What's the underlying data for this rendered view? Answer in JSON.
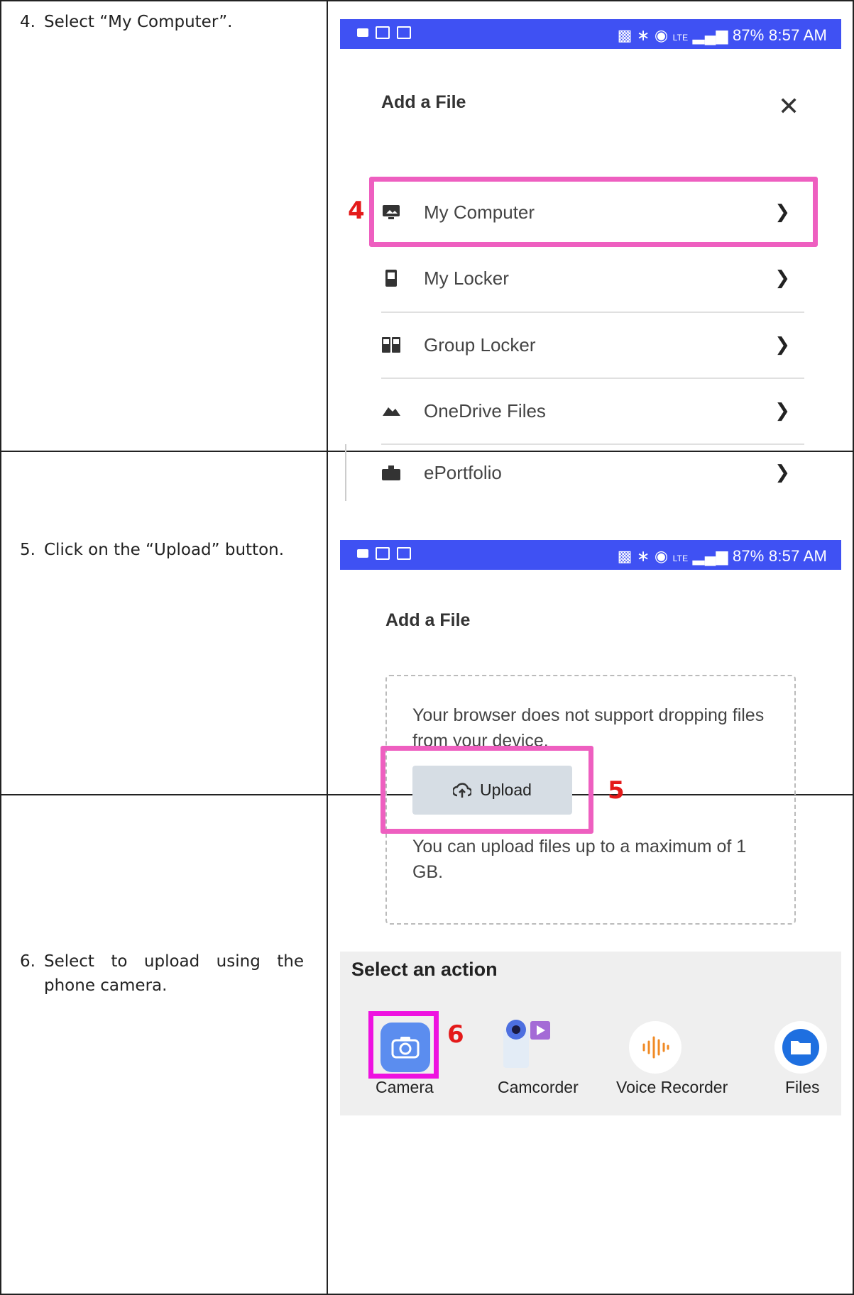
{
  "rows": [
    {
      "step_number": "4.",
      "instruction": "Select “My Computer”.",
      "status_bar": {
        "time_battery": "87% 8:57 AM",
        "network": "LTE"
      },
      "dialog_title": "Add a File",
      "close_icon": "close-icon",
      "menu_items": [
        {
          "label": "My Computer",
          "icon": "monitor-icon"
        },
        {
          "label": "My Locker",
          "icon": "locker-icon"
        },
        {
          "label": "Group Locker",
          "icon": "group-locker-icon"
        },
        {
          "label": "OneDrive Files",
          "icon": "cloud-icon"
        },
        {
          "label": "ePortfolio",
          "icon": "briefcase-icon"
        }
      ],
      "callout": "4"
    },
    {
      "step_number": "5.",
      "instruction": "Click on the “Upload” button.",
      "status_bar": {
        "time_battery": "87% 8:57 AM",
        "network": "LTE"
      },
      "dialog_title": "Add a File",
      "dropzone_text_1": "Your browser does not support dropping files from your device.",
      "upload_label": "Upload",
      "dropzone_text_2": "You can upload files up to a maximum of 1 GB.",
      "callout": "5"
    },
    {
      "step_number": "6.",
      "instruction": "Select to upload using the phone camera.",
      "sheet_title": "Select an action",
      "actions": [
        {
          "label": "Camera",
          "icon": "camera-icon",
          "color": "#5b8def"
        },
        {
          "label": "Camcorder",
          "icon": "camcorder-icon",
          "color": "#a46bd6"
        },
        {
          "label": "Voice Recorder",
          "icon": "voice-recorder-icon",
          "color": "#f08a24"
        },
        {
          "label": "Files",
          "icon": "folder-icon",
          "color": "#1e6fe0"
        }
      ],
      "callout": "6"
    }
  ],
  "colors": {
    "status_bar": "#3f51f3",
    "highlight_pink": "#ee5fc0",
    "highlight_magenta": "#ee11e0",
    "callout_red": "#e41a1a"
  }
}
